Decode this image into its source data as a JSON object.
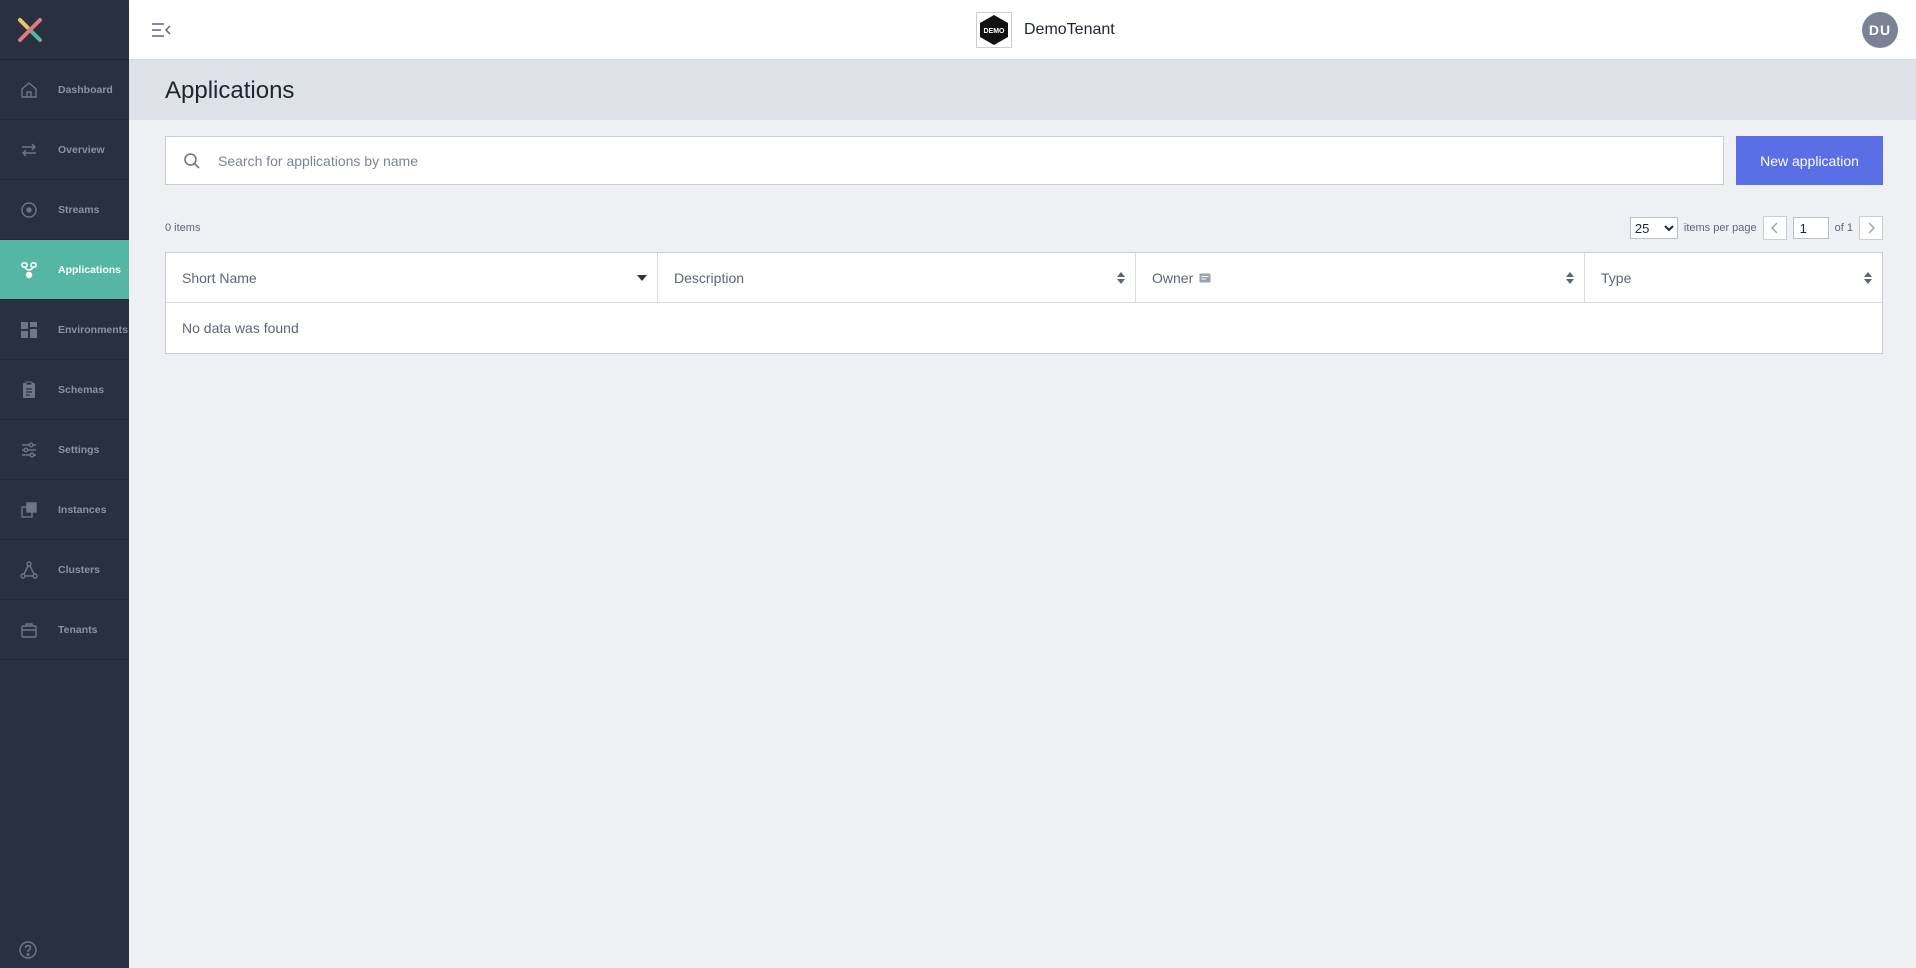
{
  "sidebar": {
    "items": [
      {
        "label": "Dashboard",
        "icon": "home-icon"
      },
      {
        "label": "Overview",
        "icon": "arrows-icon"
      },
      {
        "label": "Streams",
        "icon": "target-icon"
      },
      {
        "label": "Applications",
        "icon": "applications-icon",
        "active": true
      },
      {
        "label": "Environments",
        "icon": "grid-icon"
      },
      {
        "label": "Schemas",
        "icon": "clipboard-icon"
      },
      {
        "label": "Settings",
        "icon": "sliders-icon"
      },
      {
        "label": "Instances",
        "icon": "instances-icon"
      },
      {
        "label": "Clusters",
        "icon": "network-icon"
      },
      {
        "label": "Tenants",
        "icon": "briefcase-icon"
      }
    ],
    "help_icon": "help-icon"
  },
  "header": {
    "tenant_logo_text": "DEMO",
    "tenant_name": "DemoTenant",
    "avatar_initials": "DU"
  },
  "page": {
    "title": "Applications"
  },
  "search": {
    "placeholder": "Search for applications by name",
    "value": ""
  },
  "actions": {
    "new_button": "New application"
  },
  "pager": {
    "count": "0 items",
    "per_page_selected": "25",
    "per_page_label": "items per page",
    "page": "1",
    "of_label": "of 1"
  },
  "table": {
    "columns": [
      "Short Name",
      "Description",
      "Owner",
      "Type"
    ],
    "empty_text": "No data was found"
  },
  "colors": {
    "sidebar_bg": "#293040",
    "active_item": "#56b6a6",
    "primary_button": "#5a6ee6",
    "avatar_bg": "#7b8296"
  }
}
